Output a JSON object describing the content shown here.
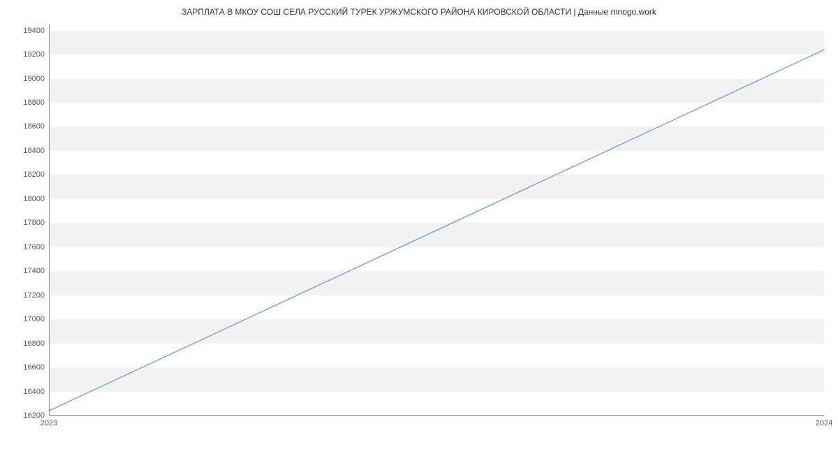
{
  "chart_data": {
    "type": "line",
    "title": "ЗАРПЛАТА В МКОУ СОШ СЕЛА РУССКИЙ ТУРЕК УРЖУМСКОГО РАЙОНА КИРОВСКОЙ ОБЛАСТИ | Данные mnogo.work",
    "xlabel": "",
    "ylabel": "",
    "x_categories": [
      "2023",
      "2024"
    ],
    "values": [
      16242,
      19242
    ],
    "ylim": [
      16200,
      19450
    ],
    "y_ticks": [
      16200,
      16400,
      16600,
      16800,
      17000,
      17200,
      17400,
      17600,
      17800,
      18000,
      18200,
      18400,
      18600,
      18800,
      19000,
      19200,
      19400
    ],
    "x_ticks": [
      "2023",
      "2024"
    ]
  }
}
